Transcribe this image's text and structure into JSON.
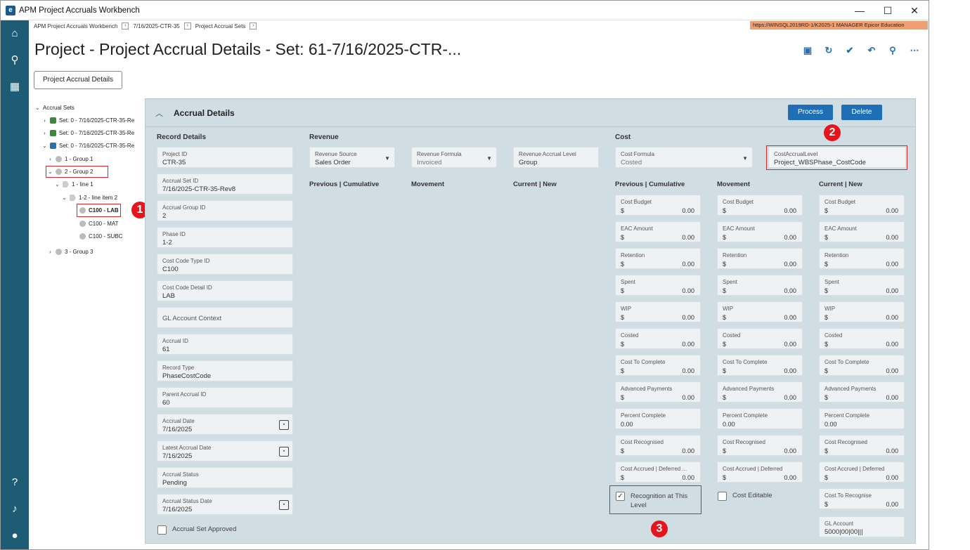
{
  "window": {
    "title": "APM Project Accruals Workbench",
    "controls": {
      "minimize": "—",
      "maximize": "☐",
      "close": "✕"
    }
  },
  "breadcrumb": [
    "APM Project Accruals Workbench",
    "7/16/2025-CTR-35",
    "Project Accrual Sets"
  ],
  "environment": "https://WINSQL2019RD-1/K2025-1   MANAGER   Epicor Education",
  "page_title": "Project - Project Accrual Details - Set: 61-7/16/2025-CTR-...",
  "tab_button": "Project Accrual Details",
  "tree": {
    "root": "Accrual Sets",
    "sets": [
      "Set: 0 - 7/16/2025-CTR-35-Re",
      "Set: 0 - 7/16/2025-CTR-35-Re",
      "Set: 0 - 7/16/2025-CTR-35-Re"
    ],
    "group1": "1 - Group 1",
    "group2": "2 - Group 2",
    "line1": "1 - line 1",
    "line2": "1-2 - line item 2",
    "lab": "C100 - LAB",
    "mat": "C100 - MAT",
    "subc": "C100 - SUBC",
    "group3": "3 - Group 3"
  },
  "panel": {
    "title": "Accrual Details",
    "process": "Process",
    "delete": "Delete"
  },
  "record": {
    "title": "Record Details",
    "fields": [
      {
        "label": "Project ID",
        "value": "CTR-35"
      },
      {
        "label": "Accrual Set ID",
        "value": "7/16/2025-CTR-35-Rev8"
      },
      {
        "label": "Accrual Group ID",
        "value": "2"
      },
      {
        "label": "Phase ID",
        "value": "1-2"
      },
      {
        "label": "Cost Code Type ID",
        "value": "C100"
      },
      {
        "label": "Cost Code Detail ID",
        "value": "LAB"
      },
      {
        "label": "GL Account Context",
        "value": ""
      },
      {
        "label": "Accrual ID",
        "value": "61"
      },
      {
        "label": "Record Type",
        "value": "PhaseCostCode"
      },
      {
        "label": "Parent Accrual ID",
        "value": "60"
      },
      {
        "label": "Accrual Date",
        "value": "7/16/2025"
      },
      {
        "label": "Latest Accrual Date",
        "value": "7/16/2025"
      },
      {
        "label": "Accrual Status",
        "value": "Pending"
      },
      {
        "label": "Accrual Status Date",
        "value": "7/16/2025"
      }
    ],
    "approved": "Accrual Set Approved"
  },
  "revenue": {
    "title": "Revenue",
    "source_label": "Revenue Source",
    "source_value": "Sales Order",
    "formula_label": "Revenue Formula",
    "formula_value": "Invoiced",
    "level_label": "Revenue Accrual Level",
    "level_value": "Group",
    "col_prev": "Previous | Cumulative",
    "col_move": "Movement",
    "col_curr": "Current | New"
  },
  "cost": {
    "title": "Cost",
    "formula_label": "Cost Formula",
    "formula_value": "Costed",
    "level_label": "CostAccrualLevel",
    "level_value": "Project_WBSPhase_CostCode",
    "col_prev": "Previous | Cumulative",
    "col_move": "Movement",
    "col_curr": "Current | New",
    "currency": "$",
    "prev": [
      {
        "label": "Cost Budget",
        "value": "0.00"
      },
      {
        "label": "EAC Amount",
        "value": "0.00"
      },
      {
        "label": "Retention",
        "value": "0.00"
      },
      {
        "label": "Spent",
        "value": "0.00"
      },
      {
        "label": "WIP",
        "value": "0.00"
      },
      {
        "label": "Costed",
        "value": "0.00"
      },
      {
        "label": "Cost To Complete",
        "value": "0.00"
      },
      {
        "label": "Advanced Payments",
        "value": "0.00"
      },
      {
        "label": "Percent Complete",
        "value": "0.00"
      },
      {
        "label": "Cost Recognised",
        "value": "0.00"
      },
      {
        "label": "Cost Accrued | Deferred ...",
        "value": "0.00"
      }
    ],
    "move": [
      {
        "label": "Cost Budget",
        "value": "0.00"
      },
      {
        "label": "EAC Amount",
        "value": "0.00"
      },
      {
        "label": "Retention",
        "value": "0.00"
      },
      {
        "label": "Spent",
        "value": "0.00"
      },
      {
        "label": "WIP",
        "value": "0.00"
      },
      {
        "label": "Costed",
        "value": "0.00"
      },
      {
        "label": "Cost To Complete",
        "value": "0.00"
      },
      {
        "label": "Advanced Payments",
        "value": "0.00"
      },
      {
        "label": "Percent Complete",
        "value": "0.00"
      },
      {
        "label": "Cost Recognised",
        "value": "0.00"
      },
      {
        "label": "Cost Accrued | Deferred",
        "value": "0.00"
      }
    ],
    "curr": [
      {
        "label": "Cost Budget",
        "value": "0.00"
      },
      {
        "label": "EAC Amount",
        "value": "0.00"
      },
      {
        "label": "Retention",
        "value": "0.00"
      },
      {
        "label": "Spent",
        "value": "0.00"
      },
      {
        "label": "WIP",
        "value": "0.00"
      },
      {
        "label": "Costed",
        "value": "0.00"
      },
      {
        "label": "Cost To Complete",
        "value": "0.00"
      },
      {
        "label": "Advanced Payments",
        "value": "0.00"
      },
      {
        "label": "Percent Complete",
        "value": "0.00"
      },
      {
        "label": "Cost Recognised",
        "value": "0.00"
      },
      {
        "label": "Cost Accrued | Deferred",
        "value": "0.00"
      },
      {
        "label": "Cost To Recognise",
        "value": "0.00"
      }
    ],
    "gl_label": "GL Account",
    "gl_value": "5000|00|00|||",
    "recognition": "Recognition at This Level",
    "editable": "Cost Editable"
  },
  "markers": [
    "1",
    "2",
    "3"
  ],
  "colors": {
    "nav": "#1d5c74",
    "accent": "#1e6fb5",
    "annotation": "#e8131b",
    "env": "#f0a070"
  }
}
